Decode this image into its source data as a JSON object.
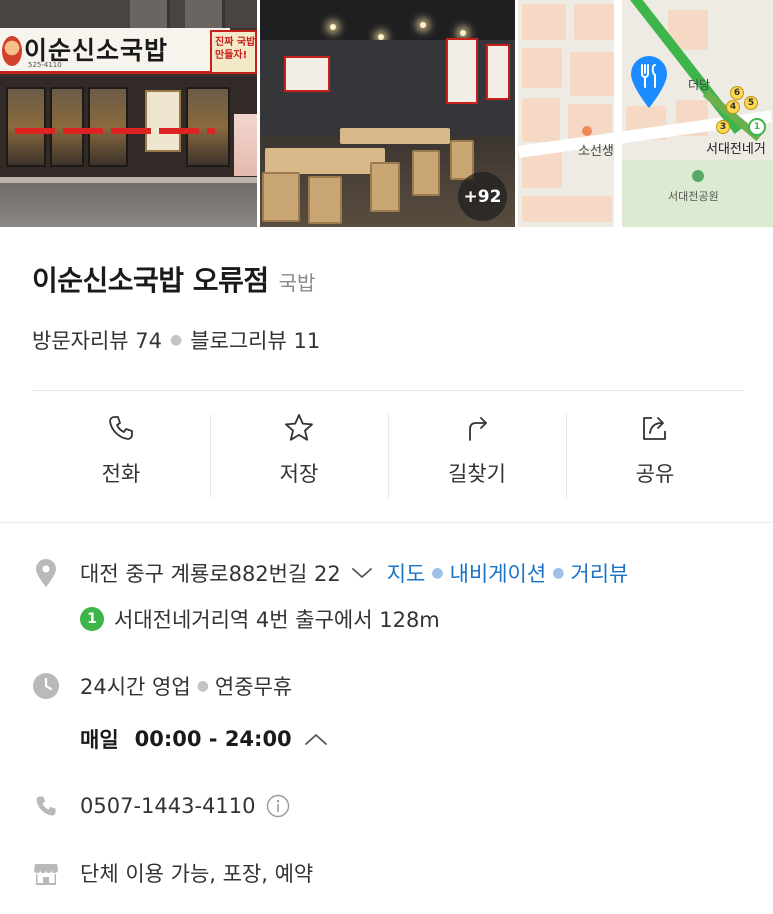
{
  "photos": {
    "storefront_sign": "이순신소국밥",
    "storefront_phone": "525-4110",
    "storefront_slogan": "진짜 국밥 만들자!",
    "more_count": "+92"
  },
  "map": {
    "labels": {
      "station": "서대전네거",
      "park": "서대전공원",
      "place1": "소선생",
      "place2": "더당"
    },
    "subway_numbers": [
      "1",
      "3",
      "4",
      "5",
      "6"
    ]
  },
  "place": {
    "name": "이순신소국밥 오류점",
    "category": "국밥",
    "visitor_reviews": "방문자리뷰 74",
    "blog_reviews": "블로그리뷰 11"
  },
  "actions": [
    {
      "label": "전화",
      "icon": "phone-icon"
    },
    {
      "label": "저장",
      "icon": "star-icon"
    },
    {
      "label": "길찾기",
      "icon": "directions-icon"
    },
    {
      "label": "공유",
      "icon": "share-icon"
    }
  ],
  "info": {
    "address": "대전 중구 계룡로882번길 22",
    "links": [
      "지도",
      "내비게이션",
      "거리뷰"
    ],
    "subway_line": "1",
    "subway_direction": "서대전네거리역 4번 출구에서 128m",
    "hours_status": "24시간 영업",
    "hours_note": "연중무휴",
    "hours_detail_day": "매일",
    "hours_detail_time": "00:00 - 24:00",
    "phone": "0507-1443-4110",
    "amenities": "단체 이용 가능, 포장, 예약"
  },
  "colors": {
    "link": "#1a73c8",
    "subway_line_1": "#3eb54a",
    "map_pin": "#1a8cff",
    "icon_grey": "#b9b9b9"
  }
}
